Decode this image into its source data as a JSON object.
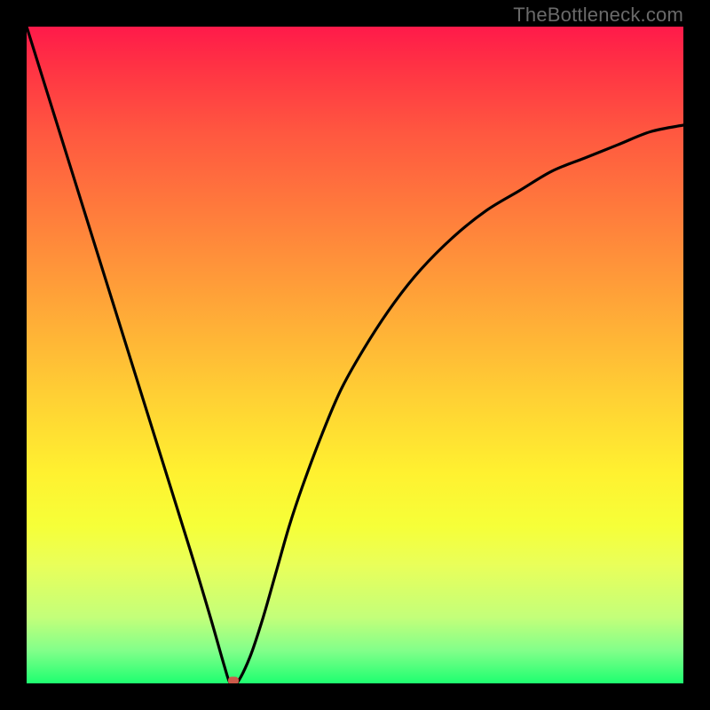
{
  "watermark": "TheBottleneck.com",
  "colors": {
    "frame": "#000000",
    "curve": "#000000",
    "marker": "#cc5a4a",
    "gradient_top": "#ff1a4a",
    "gradient_bottom": "#1eff70"
  },
  "chart_data": {
    "type": "line",
    "title": "",
    "xlabel": "",
    "ylabel": "",
    "xlim": [
      0,
      100
    ],
    "ylim": [
      0,
      100
    ],
    "grid": false,
    "series": [
      {
        "name": "bottleneck-curve",
        "x": [
          0,
          5,
          10,
          15,
          20,
          25,
          28,
          30,
          31,
          32,
          34,
          36,
          38,
          40,
          42,
          45,
          48,
          52,
          56,
          60,
          65,
          70,
          75,
          80,
          85,
          90,
          95,
          100
        ],
        "values": [
          100,
          84,
          68,
          52,
          36,
          20,
          10,
          3,
          0,
          0,
          4,
          10,
          17,
          24,
          30,
          38,
          45,
          52,
          58,
          63,
          68,
          72,
          75,
          78,
          80,
          82,
          84,
          85
        ]
      }
    ],
    "annotations": [
      {
        "name": "minimum-marker",
        "x": 31.5,
        "y": 0
      }
    ],
    "background_gradient": {
      "axis": "y",
      "stops": [
        {
          "at": 100,
          "meaning": "high-bottleneck",
          "color": "#ff1a4a"
        },
        {
          "at": 50,
          "meaning": "medium",
          "color": "#ffcf34"
        },
        {
          "at": 0,
          "meaning": "optimal",
          "color": "#1eff70"
        }
      ]
    }
  }
}
